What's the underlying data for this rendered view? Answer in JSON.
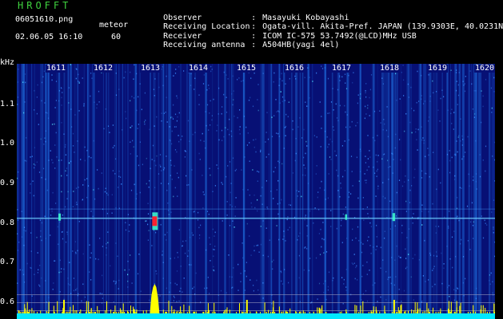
{
  "header": {
    "title": "HROFFT",
    "filename": "06051610.png",
    "datetime": "02.06.05 16:10",
    "mode": "meteor",
    "count": "60"
  },
  "meta": [
    {
      "label": "Observer",
      "sep": ":",
      "value": "Masayuki Kobayashi"
    },
    {
      "label": "Receiving Location",
      "sep": ":",
      "value": "Ogata-vill. Akita-Pref. JAPAN (139.9303E, 40.0231N)"
    },
    {
      "label": "Receiver",
      "sep": ":",
      "value": "ICOM IC-575 53.7492(@LCD)MHz USB"
    },
    {
      "label": "Receiving antenna",
      "sep": ":",
      "value": "A504HB(yagi 4el)"
    }
  ],
  "yaxis": {
    "unit": "kHz",
    "ticks": [
      "1.1",
      "1.0",
      "0.9",
      "0.8",
      "0.7",
      "0.6"
    ]
  },
  "minutes": [
    "1611",
    "1612",
    "1613",
    "1614",
    "1615",
    "1616",
    "1617",
    "1618",
    "1619",
    "1620"
  ],
  "colors": {
    "background": "#071075",
    "noise": "#1f6fe0",
    "signal_line": "#6fd0ff",
    "meteor_head": "#ff2030",
    "histogram": "#ffff00",
    "baseline": "#00e8ff",
    "title": "#3fd23f"
  },
  "chart_data": {
    "type": "heatmap",
    "ylabel": "kHz",
    "ylim": [
      0.58,
      1.18
    ],
    "x": [
      "1611",
      "1612",
      "1613",
      "1614",
      "1615",
      "1616",
      "1617",
      "1618",
      "1619",
      "1620"
    ],
    "carrier_khz": 0.805,
    "meteor_events": [
      {
        "minute": "1613",
        "khz": 0.8,
        "strength": 1.0
      },
      {
        "minute": "1611",
        "khz": 0.81,
        "strength": 0.35
      },
      {
        "minute": "1618",
        "khz": 0.81,
        "strength": 0.4
      },
      {
        "minute": "1617",
        "khz": 0.81,
        "strength": 0.25
      }
    ]
  }
}
